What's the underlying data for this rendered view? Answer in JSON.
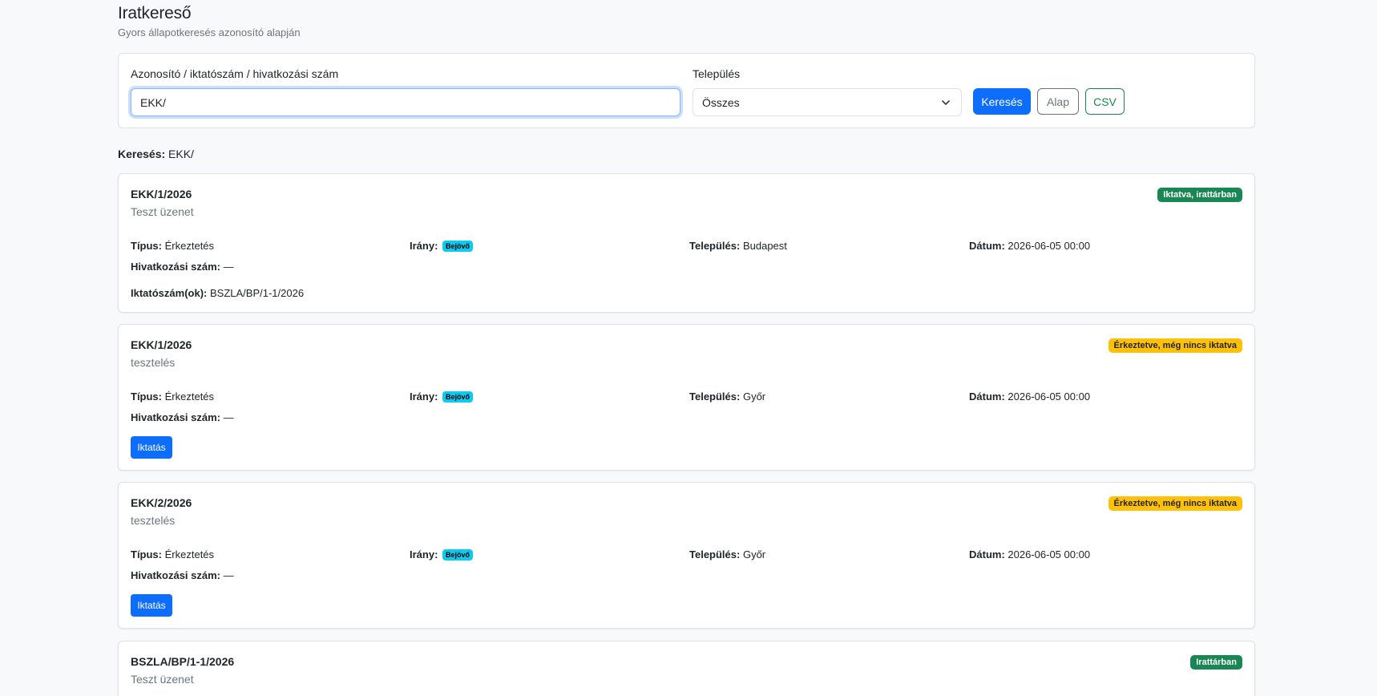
{
  "header": {
    "title": "Iratkereső",
    "subtitle": "Gyors állapotkeresés azonosító alapján"
  },
  "search_form": {
    "id_label": "Azonosító / iktatószám / hivatkozási szám",
    "id_value": "EKK/",
    "city_label": "Település",
    "city_selected": "Összes",
    "search_button": "Keresés",
    "reset_button": "Alap",
    "csv_button": "CSV"
  },
  "summary": {
    "label": "Keresés:",
    "query": "EKK/"
  },
  "labels": {
    "type": "Típus:",
    "direction": "Irány:",
    "city": "Település:",
    "date": "Dátum:",
    "reference": "Hivatkozási szám:",
    "filing_numbers": "Iktatószám(ok):"
  },
  "results": [
    {
      "id": "EKK/1/2026",
      "subject": "Teszt üzenet",
      "status": "Iktatva, irattárban",
      "status_color": "#198754",
      "type": "Érkeztetés",
      "direction": "Bejövő",
      "city": "Budapest",
      "date": "2026-06-05 00:00",
      "reference": "—",
      "filing_numbers": "BSZLA/BP/1-1/2026"
    },
    {
      "id": "EKK/1/2026",
      "subject": "tesztelés",
      "status": "Érkeztetve, még nincs iktatva",
      "status_color": "#ffc107",
      "type": "Érkeztetés",
      "direction": "Bejövő",
      "city": "Győr",
      "date": "2026-06-05 00:00",
      "reference": "—",
      "action_button": "Iktatás"
    },
    {
      "id": "EKK/2/2026",
      "subject": "tesztelés",
      "status": "Érkeztetve, még nincs iktatva",
      "status_color": "#ffc107",
      "type": "Érkeztetés",
      "direction": "Bejövő",
      "city": "Győr",
      "date": "2026-06-05 00:00",
      "reference": "—",
      "action_button": "Iktatás"
    },
    {
      "id": "BSZLA/BP/1-1/2026",
      "subject": "Teszt üzenet",
      "status": "Irattárban",
      "status_color": "#198754"
    }
  ],
  "colors": {
    "primary": "#0d6efd",
    "success": "#198754",
    "warning": "#ffc107",
    "info": "#0dcaf0",
    "background": "#f8f9fa"
  }
}
